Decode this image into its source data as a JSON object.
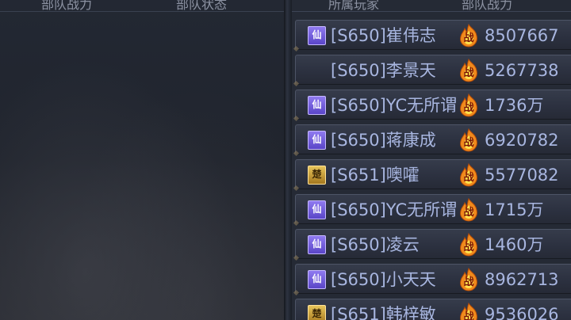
{
  "left_header": {
    "col1": "部队战力",
    "col2": "部队状态"
  },
  "right_header": {
    "col1": "所属玩家",
    "col2": "部队战力"
  },
  "battle_icon_char": "战",
  "rows": [
    {
      "faction": "仙",
      "faction_type": "xian",
      "player": "[S650]崔伟志",
      "power": "8507667"
    },
    {
      "faction": "",
      "faction_type": "empty",
      "player": "[S650]李景天",
      "power": "5267738"
    },
    {
      "faction": "仙",
      "faction_type": "xian",
      "player": "[S650]YC无所谓",
      "power": "1736万"
    },
    {
      "faction": "仙",
      "faction_type": "xian",
      "player": "[S650]蒋康成",
      "power": "6920782"
    },
    {
      "faction": "楚",
      "faction_type": "chu",
      "player": "[S651]噢嚯",
      "power": "5577082"
    },
    {
      "faction": "仙",
      "faction_type": "xian",
      "player": "[S650]YC无所谓",
      "power": "1715万"
    },
    {
      "faction": "仙",
      "faction_type": "xian",
      "player": "[S650]凌云",
      "power": "1460万"
    },
    {
      "faction": "仙",
      "faction_type": "xian",
      "player": "[S650]小天天",
      "power": "8962713"
    },
    {
      "faction": "楚",
      "faction_type": "chu",
      "player": "[S651]韩梓敏",
      "power": "9536026"
    }
  ],
  "colors": {
    "text": "#a8b6e0",
    "xian_badge": "#6c57dc",
    "chu_badge": "#d1a53e",
    "fire_outer": "#f08a1c",
    "fire_inner": "#ffe14d"
  }
}
